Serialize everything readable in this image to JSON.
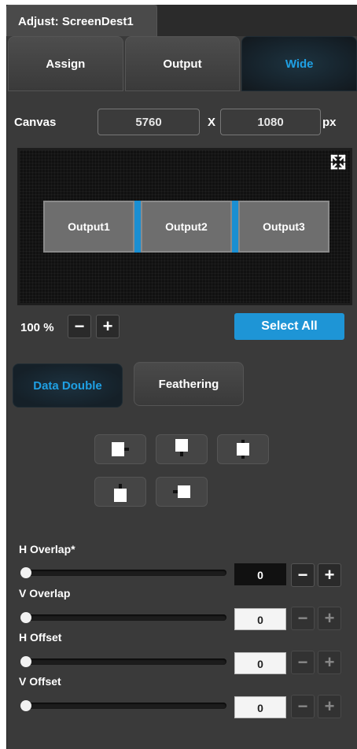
{
  "window": {
    "title": "Adjust: ScreenDest1"
  },
  "tabs": [
    {
      "label": "Assign",
      "active": false
    },
    {
      "label": "Output",
      "active": false
    },
    {
      "label": "Wide",
      "active": true
    }
  ],
  "canvas": {
    "label": "Canvas",
    "width": "5760",
    "x_label": "X",
    "height": "1080",
    "unit": "px"
  },
  "preview": {
    "expand_icon": "expand-icon",
    "outputs": [
      "Output1",
      "Output2",
      "Output3"
    ],
    "separator_color": "#1a8fd2"
  },
  "zoom": {
    "level": "100 %",
    "minus": "−",
    "plus": "+"
  },
  "select_all": "Select All",
  "modes": {
    "data_double": "Data Double",
    "feathering": "Feathering",
    "active": "data_double"
  },
  "align_icons": [
    "align-top-right-icon",
    "align-top-center-icon",
    "align-center-icon",
    "align-bottom-center-icon",
    "align-left-center-icon"
  ],
  "sliders": [
    {
      "label": "H Overlap*",
      "value": "0",
      "active": true
    },
    {
      "label": "V Overlap",
      "value": "0",
      "active": false
    },
    {
      "label": "H Offset",
      "value": "0",
      "active": false
    },
    {
      "label": "V Offset",
      "value": "0",
      "active": false
    }
  ],
  "colors": {
    "accent": "#1e95d6",
    "panel": "#3a3a3a"
  }
}
